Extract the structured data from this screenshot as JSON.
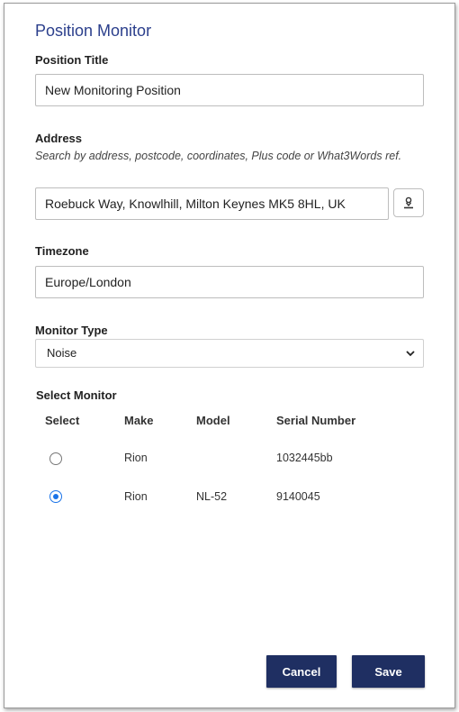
{
  "dialog": {
    "title": "Position Monitor"
  },
  "position_title": {
    "label": "Position Title",
    "value": "New Monitoring Position"
  },
  "address": {
    "label": "Address",
    "hint": "Search by address, postcode, coordinates, Plus code or What3Words ref.",
    "value": "Roebuck Way, Knowlhill, Milton Keynes MK5 8HL, UK",
    "locate_icon": "person-pin-icon"
  },
  "timezone": {
    "label": "Timezone",
    "value": "Europe/London"
  },
  "monitor_type": {
    "label": "Monitor Type",
    "selected": "Noise"
  },
  "select_monitor": {
    "label": "Select Monitor",
    "columns": {
      "select": "Select",
      "make": "Make",
      "model": "Model",
      "serial": "Serial Number"
    },
    "rows": [
      {
        "make": "Rion",
        "model": "",
        "serial": "1032445bb",
        "selected": false
      },
      {
        "make": "Rion",
        "model": "NL-52",
        "serial": "9140045",
        "selected": true
      }
    ]
  },
  "buttons": {
    "cancel": "Cancel",
    "save": "Save"
  },
  "colors": {
    "title": "#2b3f8c",
    "button_bg": "#1f2f62",
    "radio_checked": "#1a73e8"
  }
}
